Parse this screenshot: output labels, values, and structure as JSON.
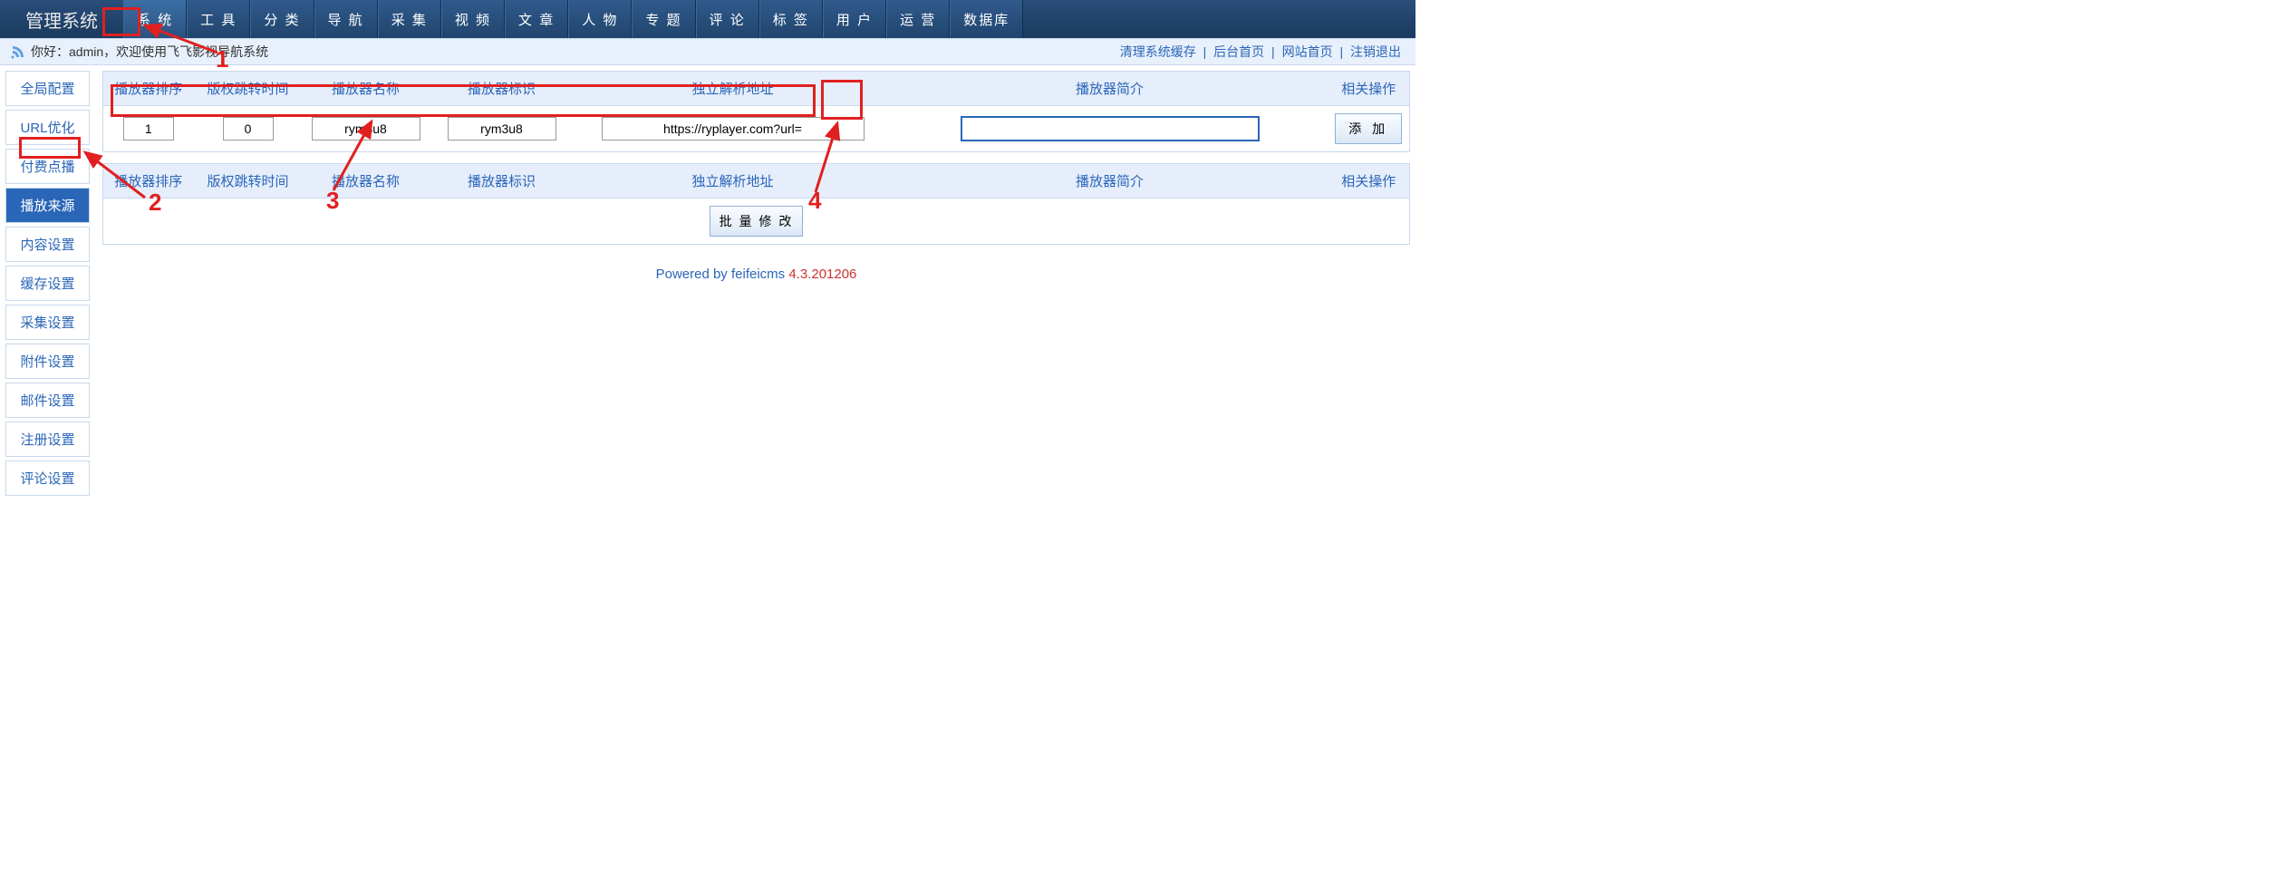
{
  "header": {
    "logo": "管理系统",
    "nav": [
      "系 统",
      "工 具",
      "分 类",
      "导 航",
      "采 集",
      "视 频",
      "文 章",
      "人 物",
      "专 题",
      "评 论",
      "标 签",
      "用 户",
      "运 营",
      "数据库"
    ],
    "nav_active_index": 0
  },
  "greet": {
    "hello_prefix": "你好：",
    "user": "admin",
    "hello_suffix": "，欢迎使用飞飞影视导航系统",
    "links": [
      "清理系统缓存",
      "后台首页",
      "网站首页",
      "注销退出"
    ]
  },
  "sidebar": {
    "items": [
      "全局配置",
      "URL优化",
      "付费点播",
      "播放来源",
      "内容设置",
      "缓存设置",
      "采集设置",
      "附件设置",
      "邮件设置",
      "注册设置",
      "评论设置"
    ],
    "active_index": 3
  },
  "table": {
    "headers": [
      "播放器排序",
      "版权跳转时间",
      "播放器名称",
      "播放器标识",
      "独立解析地址",
      "播放器简介",
      "相关操作"
    ],
    "row": {
      "sort": "1",
      "jump_time": "0",
      "name": "rym3u8",
      "ident": "rym3u8",
      "parse_url": "https://ryplayer.com?url=",
      "intro": ""
    },
    "add_btn": "添 加",
    "batch_btn": "批 量 修 改"
  },
  "footer": {
    "powered": "Powered by feifeicms ",
    "version": "4.3.201206"
  },
  "annotations": {
    "n1": "1",
    "n2": "2",
    "n3": "3",
    "n4": "4"
  }
}
